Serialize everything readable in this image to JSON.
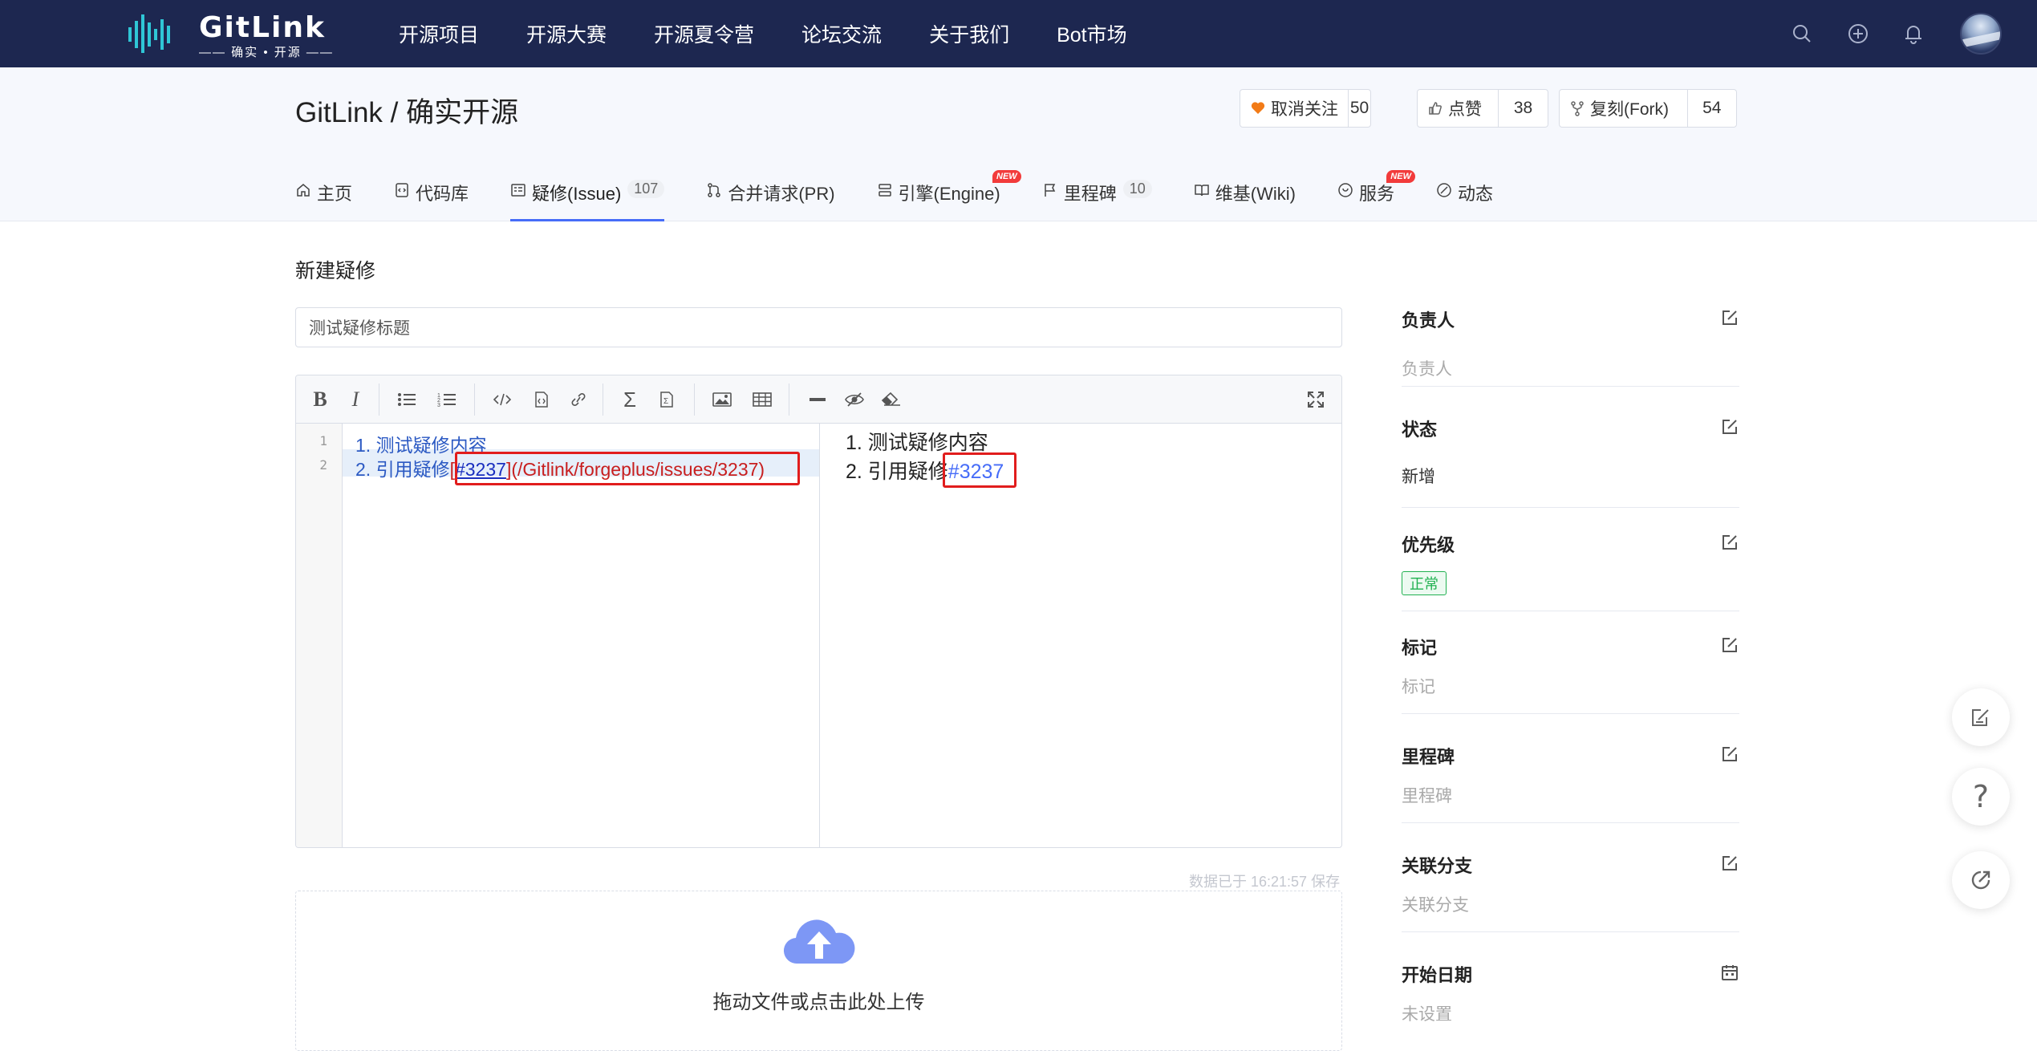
{
  "brand": {
    "name": "GitLink",
    "tagline": "—— 确实 • 开源 ——"
  },
  "nav": {
    "items": [
      "开源项目",
      "开源大赛",
      "开源夏令营",
      "论坛交流",
      "关于我们",
      "Bot市场"
    ]
  },
  "repo": {
    "title": "GitLink / 确实开源"
  },
  "actions": {
    "watch_label": "取消关注",
    "watch_count": "50",
    "star_label": "点赞",
    "star_count": "38",
    "fork_label": "复刻(Fork)",
    "fork_count": "54"
  },
  "tabs": [
    {
      "label": "主页",
      "icon": "home-icon"
    },
    {
      "label": "代码库",
      "icon": "code-file-icon"
    },
    {
      "label": "疑修(Issue)",
      "badge": "107",
      "icon": "issue-icon",
      "active": true
    },
    {
      "label": "合并请求(PR)",
      "icon": "merge-icon"
    },
    {
      "label": "引擎(Engine)",
      "new_tag": "NEW",
      "icon": "engine-icon"
    },
    {
      "label": "里程碑",
      "badge": "10",
      "icon": "flag-icon"
    },
    {
      "label": "维基(Wiki)",
      "icon": "book-icon"
    },
    {
      "label": "服务",
      "new_tag": "NEW",
      "icon": "service-icon"
    },
    {
      "label": "动态",
      "icon": "activity-icon"
    }
  ],
  "page": {
    "section_title": "新建疑修"
  },
  "issue_title": {
    "value": "测试疑修标题"
  },
  "editor": {
    "line_numbers": [
      "1",
      "2"
    ],
    "line1": "1. 测试疑修内容",
    "line2_prefix": "2. 引用疑修",
    "line2_bracket_open": "[",
    "line2_link": "#3237",
    "line2_rest": "](/Gitlink/forgeplus/issues/3237)",
    "preview_line1": "1. 测试疑修内容",
    "preview_line2_prefix": "2. 引用疑修",
    "preview_line2_ref": "#3237"
  },
  "saved_note": "数据已于 16:21:57 保存",
  "upload": {
    "text": "拖动文件或点击此处上传"
  },
  "sidebar": {
    "assignee": {
      "label": "负责人",
      "value": "负责人"
    },
    "status": {
      "label": "状态",
      "value": "新增"
    },
    "priority": {
      "label": "优先级",
      "value": "正常"
    },
    "tags": {
      "label": "标记",
      "value": "标记"
    },
    "milestone": {
      "label": "里程碑",
      "value": "里程碑"
    },
    "branch": {
      "label": "关联分支",
      "value": "关联分支"
    },
    "start_date": {
      "label": "开始日期",
      "value": "未设置"
    }
  },
  "colors": {
    "nav_bg": "#1d2750",
    "accent": "#466cf8",
    "highlight_box": "#e11d1d",
    "priority_green": "#21b151"
  }
}
